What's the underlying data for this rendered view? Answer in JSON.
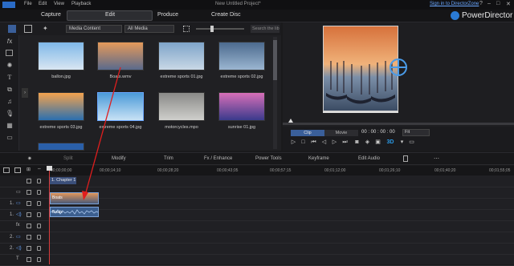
{
  "app": {
    "title": "New Untitled Project*",
    "brand": "PowerDirector",
    "sign_in": "Sign in to DirectorZone",
    "menu": [
      "File",
      "Edit",
      "View",
      "Playback"
    ],
    "window_controls": [
      "?",
      "–",
      "□",
      "✕"
    ]
  },
  "modes": [
    {
      "label": "Capture",
      "active": false
    },
    {
      "label": "Edit",
      "active": true
    },
    {
      "label": "Produce",
      "active": false
    },
    {
      "label": "Create Disc",
      "active": false
    }
  ],
  "library": {
    "filter_content": "Media Content",
    "filter_media": "All Media",
    "search_placeholder": "Search the lib",
    "items": [
      {
        "name": "ballon.jpg",
        "colors": [
          "#7fb8e8",
          "#d9e6f2"
        ]
      },
      {
        "name": "Boats.wmv",
        "colors": [
          "#e59a5a",
          "#5a6a8c"
        ]
      },
      {
        "name": "extreme sports 01.jpg",
        "colors": [
          "#7ea4c9",
          "#c9d8e6"
        ]
      },
      {
        "name": "extreme sports 02.jpg",
        "colors": [
          "#4c6a8e",
          "#9bb6d1"
        ]
      },
      {
        "name": "extreme sports 03.jpg",
        "colors": [
          "#f4a34e",
          "#2a6fb0"
        ]
      },
      {
        "name": "extreme sports 04.jpg",
        "colors": [
          "#4a9ad8",
          "#c8e2f5"
        ]
      },
      {
        "name": "motorcycles.mpo",
        "colors": [
          "#8a8a88",
          "#cfcfcc"
        ]
      },
      {
        "name": "sunrise 01.jpg",
        "colors": [
          "#d86fb8",
          "#3a3a8c"
        ]
      }
    ]
  },
  "preview": {
    "tabs": [
      {
        "label": "Clip",
        "active": true
      },
      {
        "label": "Movie",
        "active": false
      }
    ],
    "timecode": "00 : 00 : 00 : 00",
    "zoom": "Fit",
    "three_d": "3D"
  },
  "edit_toolbar": [
    "Split",
    "Modify",
    "Trim",
    "Fx / Enhance",
    "Power Tools",
    "Keyframe",
    "Edit Audio"
  ],
  "ruler": [
    "00;00;00;00",
    "00;00;14;10",
    "00;00;28;20",
    "00;00;43;05",
    "00;00;57;15",
    "00;01;12;00",
    "00;01;26;10",
    "00;01;40;20",
    "00;01;55;05"
  ],
  "timeline": {
    "chapter": "1. Chapter 1",
    "video_clip": "Boats",
    "audio_clip": "Boats",
    "tracks": [
      {
        "num": "",
        "icon": "chapter"
      },
      {
        "num": "",
        "icon": "subtitle"
      },
      {
        "num": "1.",
        "icon": "video"
      },
      {
        "num": "1.",
        "icon": "audio"
      },
      {
        "num": "",
        "icon": "fx"
      },
      {
        "num": "2.",
        "icon": "video"
      },
      {
        "num": "2.",
        "icon": "audio"
      },
      {
        "num": "",
        "icon": "title"
      }
    ]
  },
  "colors": {
    "accent": "#2a7bd6",
    "playhead": "#d63a3a",
    "arrow": "#e01e1e"
  }
}
